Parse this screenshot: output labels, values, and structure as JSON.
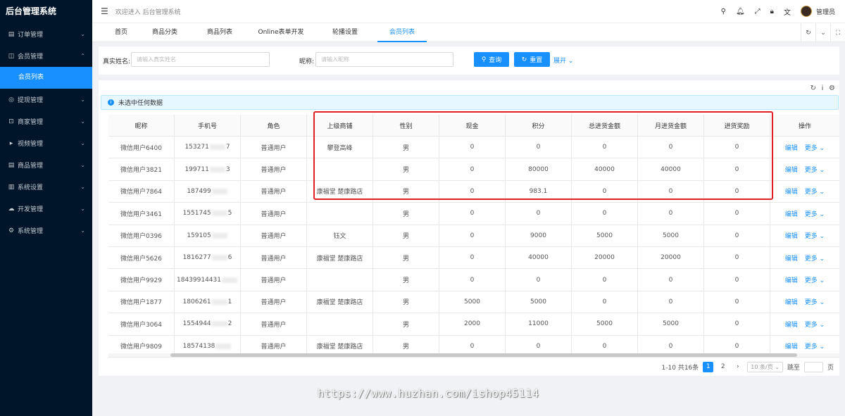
{
  "app": {
    "title": "后台管理系统",
    "welcome": "欢迎进入 后台管理系统",
    "username": "管理员"
  },
  "sidebar": {
    "items": [
      {
        "label": "订单管理",
        "icon": "list-icon",
        "arrow": "⌄"
      },
      {
        "label": "会员管理",
        "icon": "member-icon",
        "arrow": "⌃"
      },
      {
        "label": "提现管理",
        "icon": "withdraw-icon",
        "arrow": "⌄"
      },
      {
        "label": "商家管理",
        "icon": "shop-icon",
        "arrow": "⌄"
      },
      {
        "label": "视频管理",
        "icon": "video-icon",
        "arrow": "⌄"
      },
      {
        "label": "商品管理",
        "icon": "goods-icon",
        "arrow": "⌄"
      },
      {
        "label": "系统设置",
        "icon": "settings-icon",
        "arrow": "⌄"
      },
      {
        "label": "开发管理",
        "icon": "cloud-icon",
        "arrow": "⌄"
      },
      {
        "label": "系统管理",
        "icon": "gear-icon",
        "arrow": "⌄"
      }
    ],
    "active_sub": "会员列表"
  },
  "tabs": [
    "首页",
    "商品分类",
    "商品列表",
    "Online表单开发",
    "轮播设置",
    "会员列表"
  ],
  "active_tab": "会员列表",
  "search": {
    "realname_label": "真实姓名:",
    "realname_placeholder": "请输入真实姓名",
    "nickname_label": "昵称:",
    "nickname_placeholder": "请输入昵称",
    "query_label": "查询",
    "reset_label": "重置",
    "expand_label": "展开"
  },
  "alert_text": "未选中任何数据",
  "table": {
    "columns": [
      "昵称",
      "手机号",
      "角色",
      "上级商铺",
      "性别",
      "现金",
      "积分",
      "总进货金额",
      "月进货金额",
      "进货奖励",
      "操作"
    ],
    "edit_label": "编辑",
    "more_label": "更多",
    "rows": [
      [
        "微信用户6400",
        "153271",
        "7",
        "普通用户",
        "攀登高峰",
        "男",
        "0",
        "0",
        "0",
        "0",
        "0"
      ],
      [
        "微信用户3821",
        "199711",
        "3",
        "普通用户",
        "",
        "男",
        "0",
        "80000",
        "40000",
        "40000",
        "0"
      ],
      [
        "微信用户7864",
        "187499",
        "",
        "普通用户",
        "康福堂 楚康路店",
        "男",
        "0",
        "983.1",
        "0",
        "0",
        "0"
      ],
      [
        "微信用户3461",
        "1551745",
        "5",
        "普通用户",
        "",
        "男",
        "0",
        "0",
        "0",
        "0",
        "0"
      ],
      [
        "微信用户0396",
        "159105",
        "",
        "普通用户",
        "钰文",
        "男",
        "0",
        "9000",
        "5000",
        "5000",
        "0"
      ],
      [
        "微信用户5626",
        "1816277",
        "6",
        "普通用户",
        "康福堂 楚康路店",
        "男",
        "0",
        "40000",
        "20000",
        "20000",
        "0"
      ],
      [
        "微信用户9929",
        "18439914431",
        "",
        "普通用户",
        "",
        "男",
        "0",
        "0",
        "0",
        "0",
        "0"
      ],
      [
        "微信用户1877",
        "1806261",
        "1",
        "普通用户",
        "康福堂 楚康路店",
        "男",
        "5000",
        "5000",
        "0",
        "0",
        "0"
      ],
      [
        "微信用户3064",
        "1554944",
        "2",
        "普通用户",
        "",
        "男",
        "2000",
        "11000",
        "5000",
        "5000",
        "0"
      ],
      [
        "微信用户9809",
        "18574138",
        "",
        "普通用户",
        "康福堂 楚康路店",
        "男",
        "0",
        "0",
        "0",
        "0",
        "0"
      ]
    ]
  },
  "pagination": {
    "summary": "1-10 共16条",
    "pages": [
      "1",
      "2"
    ],
    "current": "1",
    "size_label": "10 条/页",
    "goto_label": "跳至",
    "page_suffix": "页"
  },
  "watermark": "https://www.huzhan.com/ishop45114",
  "colors": {
    "primary": "#1890ff",
    "sidebar_bg": "#001529",
    "highlight": "#e02020"
  }
}
